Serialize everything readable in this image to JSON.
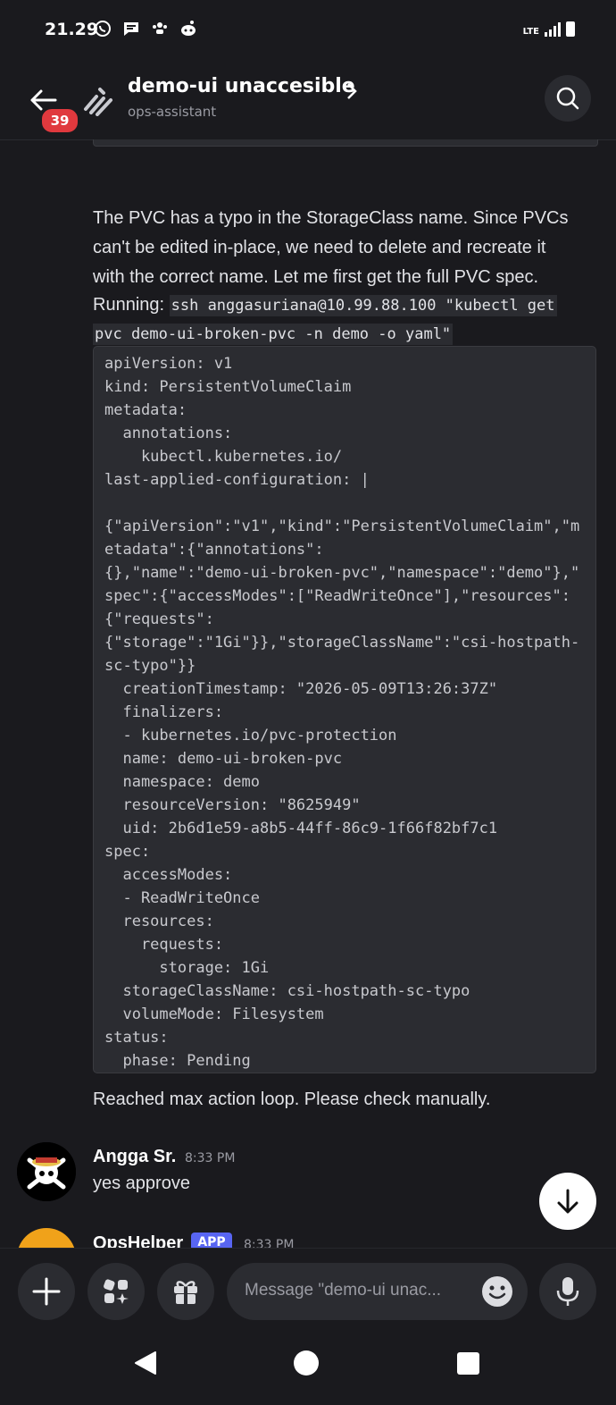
{
  "status_bar": {
    "time": "21.29",
    "network": "LTE"
  },
  "header": {
    "unread_count": "39",
    "thread_title": "demo-ui unaccesible",
    "channel_name": "ops-assistant"
  },
  "messages": {
    "bot_paragraph_lines": [
      "The PVC has a typo in the StorageClass name. Since PVCs",
      "can't be edited in-place, we need to delete and recreate it",
      "with the correct name. Let me first get the full PVC spec."
    ],
    "running_label": "Running:",
    "running_command_1": "ssh anggasuriana@10.99.88.100 \"kubectl get",
    "running_command_2": "pvc demo-ui-broken-pvc -n demo -o yaml\"",
    "code_output": "apiVersion: v1\nkind: PersistentVolumeClaim\nmetadata:\n  annotations:\n    kubectl.kubernetes.io/\nlast-applied-configuration: |\n\n{\"apiVersion\":\"v1\",\"kind\":\"PersistentVolumeClaim\",\"m\netadata\":{\"annotations\":\n{},\"name\":\"demo-ui-broken-pvc\",\"namespace\":\"demo\"},\"\nspec\":{\"accessModes\":[\"ReadWriteOnce\"],\"resources\":\n{\"requests\":\n{\"storage\":\"1Gi\"}},\"storageClassName\":\"csi-hostpath-\nsc-typo\"}}\n  creationTimestamp: \"2026-05-09T13:26:37Z\"\n  finalizers:\n  - kubernetes.io/pvc-protection\n  name: demo-ui-broken-pvc\n  namespace: demo\n  resourceVersion: \"8625949\"\n  uid: 2b6d1e59-a8b5-44ff-86c9-1f66f82bf7c1\nspec:\n  accessModes:\n  - ReadWriteOnce\n  resources:\n    requests:\n      storage: 1Gi\n  storageClassName: csi-hostpath-sc-typo\n  volumeMode: Filesystem\nstatus:\n  phase: Pending",
    "bot_footer": "Reached max action loop. Please check manually.",
    "user_author": "Angga Sr.",
    "user_time": "8:33 PM",
    "user_text": "yes approve",
    "next_author": "OpsHelper",
    "next_badge": "APP",
    "next_time": "8:33 PM"
  },
  "composer": {
    "placeholder": "Message \"demo-ui unac..."
  },
  "colors": {
    "background": "#1a1a1e",
    "code_bg": "#2b2c31",
    "badge_red": "#e0393e",
    "app_badge": "#5865f2",
    "avatar_orange": "#f0a21a"
  },
  "icons": [
    "back-arrow-icon",
    "thread-icon",
    "chevron-right-icon",
    "search-icon",
    "arrow-down-icon",
    "plus-icon",
    "apps-icon",
    "gift-icon",
    "emoji-icon",
    "microphone-icon",
    "nav-back-icon",
    "nav-home-icon",
    "nav-recents-icon"
  ]
}
